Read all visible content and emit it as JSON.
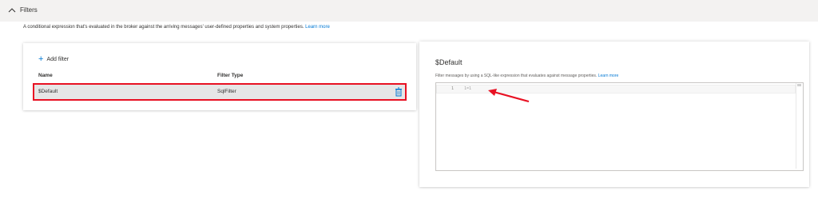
{
  "section": {
    "title": "Filters",
    "description": "A conditional expression that's evaluated in the broker against the arriving messages' user-defined properties and system properties.",
    "learn_more": "Learn more"
  },
  "filters_table": {
    "add_filter_label": "Add filter",
    "columns": [
      "Name",
      "Filter Type"
    ],
    "rows": [
      {
        "name": "$Default",
        "filter_type": "SqlFilter"
      }
    ]
  },
  "detail": {
    "title": "$Default",
    "description": "Filter messages by using a SQL-like expression that evaluates against message properties.",
    "learn_more": "Learn more",
    "editor": {
      "line_number": "1",
      "code": "1=1"
    }
  },
  "colors": {
    "accent": "#0078d4",
    "highlight_border": "#e81123",
    "annotation_arrow": "#e81123"
  },
  "icons": [
    "chevron-up-icon",
    "plus-icon",
    "trash-icon"
  ]
}
